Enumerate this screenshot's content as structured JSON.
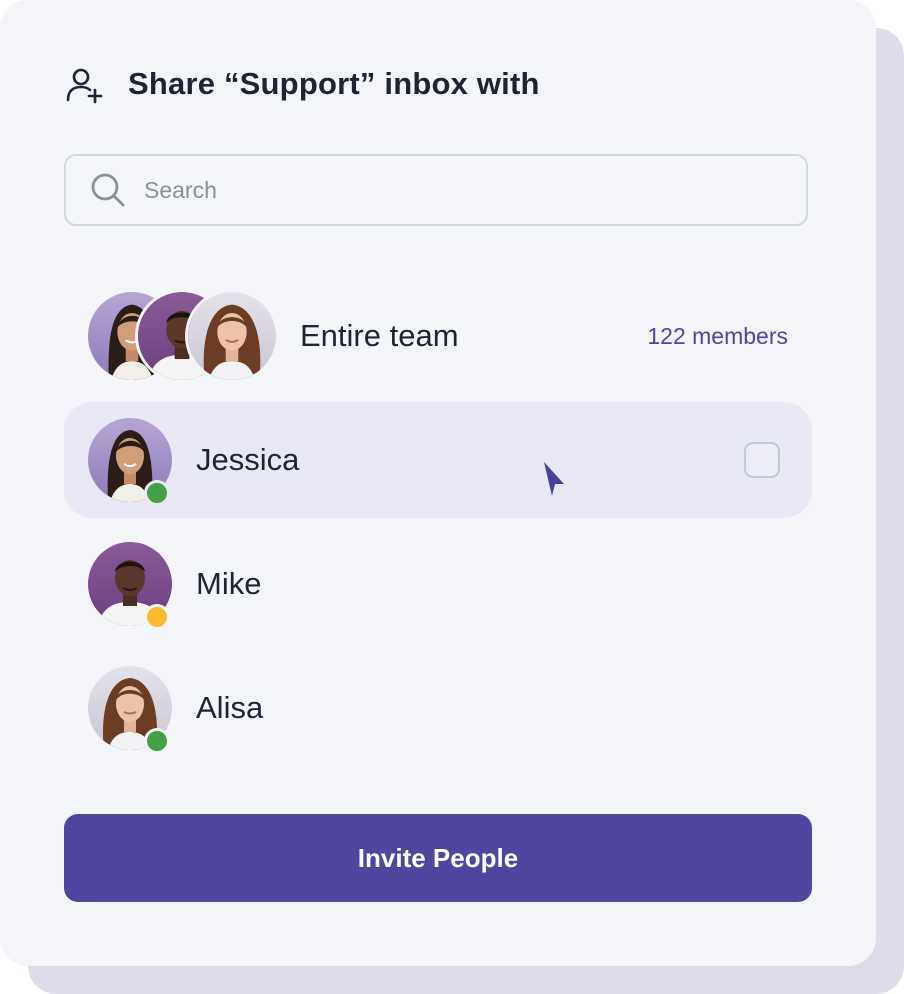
{
  "header": {
    "title": "Share “Support” inbox with",
    "icon": "add-user-icon"
  },
  "search": {
    "placeholder": "Search",
    "value": "",
    "icon": "search-icon"
  },
  "team": {
    "label": "Entire team",
    "members": "122 members"
  },
  "people": [
    {
      "name": "Jessica",
      "status": "online",
      "status_color": "#43a047",
      "hovered": true,
      "checked": false
    },
    {
      "name": "Mike",
      "status": "away",
      "status_color": "#fbbc2c"
    },
    {
      "name": "Alisa",
      "status": "online",
      "status_color": "#43a047"
    }
  ],
  "invite_button": {
    "label": "Invite People"
  },
  "colors": {
    "accent": "#5046a0",
    "accent_text": "#5244a3",
    "card": "#f4f5f9",
    "hover_row": "#e8e9f4"
  }
}
